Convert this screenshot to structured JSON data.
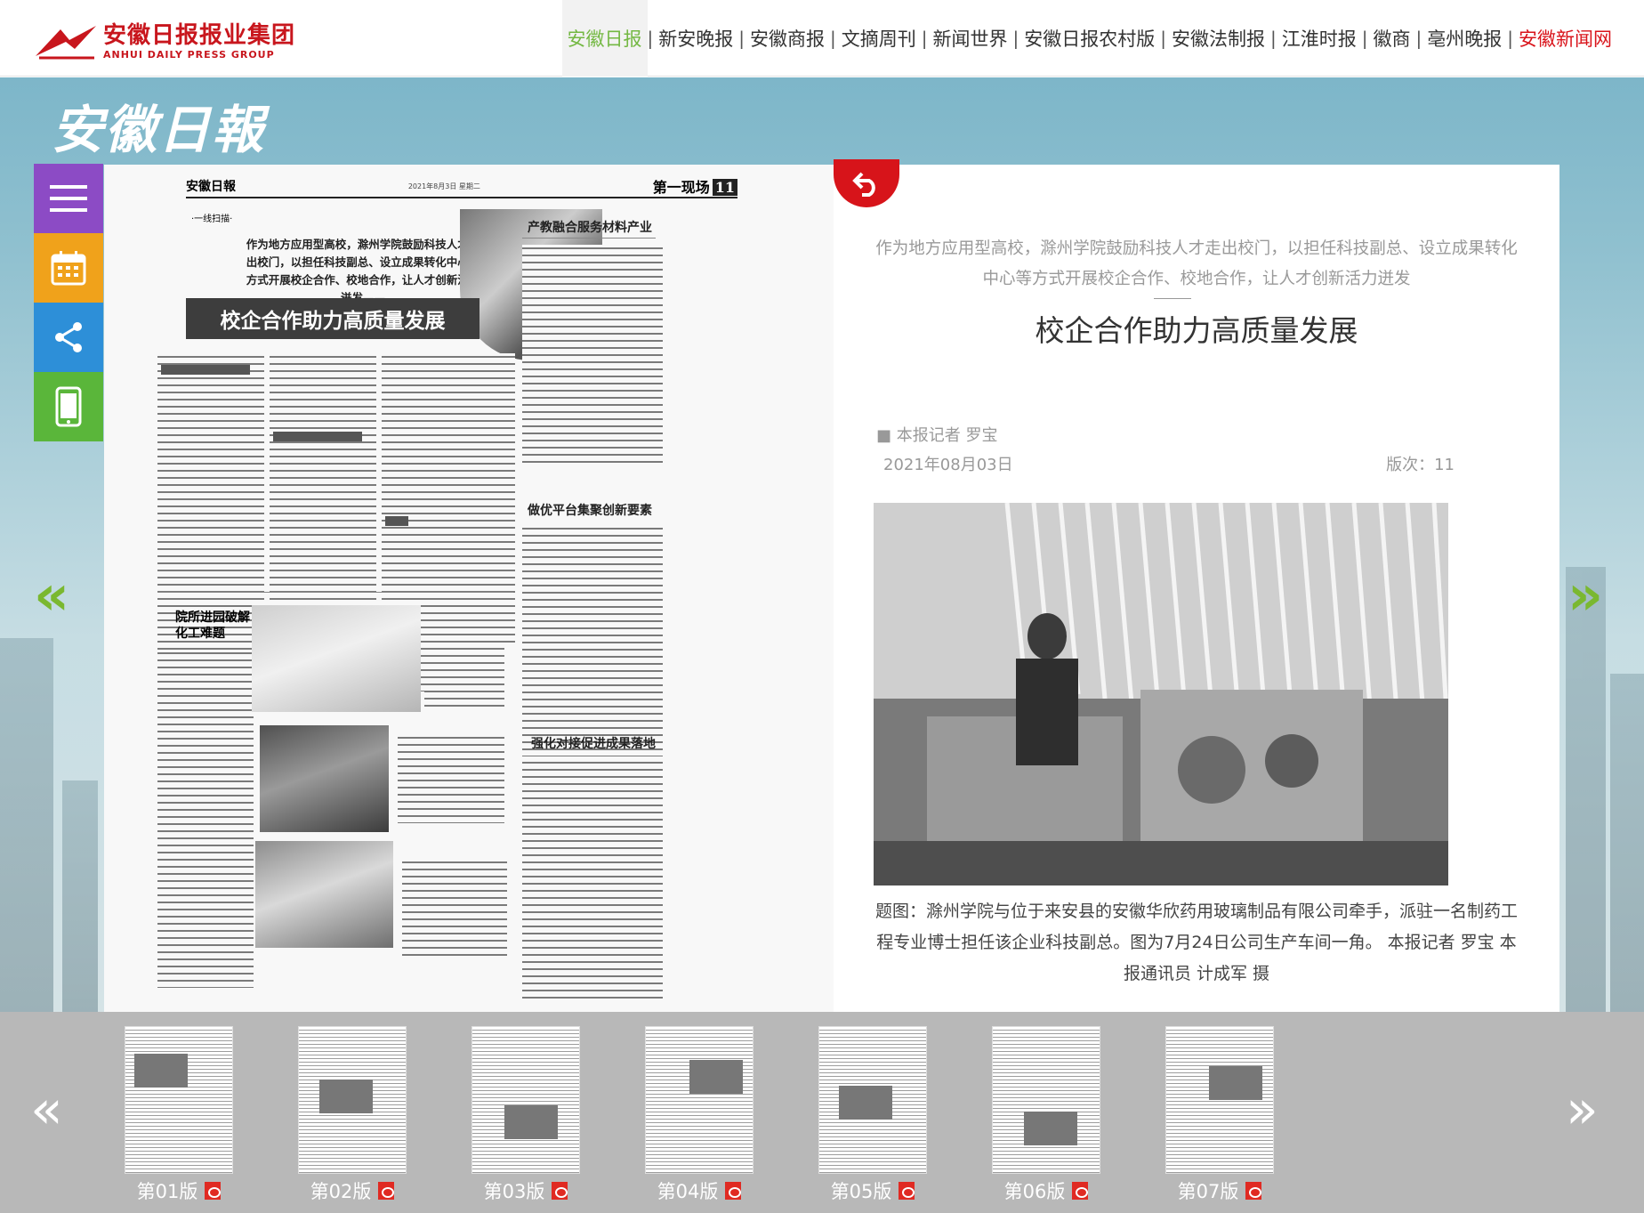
{
  "header": {
    "logo_cn": "安徽日报报业集团",
    "logo_en": "ANHUI DAILY PRESS GROUP",
    "nav": [
      {
        "label": "安徽日报",
        "active": true
      },
      {
        "label": "新安晚报"
      },
      {
        "label": "安徽商报"
      },
      {
        "label": "文摘周刊"
      },
      {
        "label": "新闻世界"
      },
      {
        "label": "安徽日报农村版"
      },
      {
        "label": "安徽法制报"
      },
      {
        "label": "江淮时报"
      },
      {
        "label": "徽商"
      },
      {
        "label": "亳州晚报"
      },
      {
        "label": "安徽新闻网",
        "red": true
      }
    ],
    "separator": "|"
  },
  "paper_name": "安徽日報",
  "sidebar": {
    "buttons": [
      {
        "icon": "menu-icon",
        "color": "#8c4bc5"
      },
      {
        "icon": "calendar-icon",
        "color": "#f0a21b"
      },
      {
        "icon": "share-icon",
        "color": "#2d8fd8"
      },
      {
        "icon": "mobile-icon",
        "color": "#5ab63a"
      }
    ]
  },
  "newspaper": {
    "masthead": "安徽日報",
    "masthead_sub": "2021年8月3日 星期二",
    "section": "第一现场",
    "page_no": "11",
    "tag": "·一线扫描·",
    "lead": "作为地方应用型高校，滁州学院鼓励科技人才走出校门，以担任科技副总、设立成果转化中心等方式开展校企合作、校地合作，让人才创新活力迸发——",
    "headline": "校企合作助力高质量发展",
    "sub1": "产教融合服务材料产业",
    "sub2": "做优平台集聚创新要素",
    "sub3": "院所进园破解化工难题",
    "sub4": "强化对接促进成果落地"
  },
  "article": {
    "lead": "作为地方应用型高校，滁州学院鼓励科技人才走出校门，以担任科技副总、设立成果转化中心等方式开展校企合作、校地合作，让人才创新活力迸发",
    "title": "校企合作助力高质量发展",
    "author": "■ 本报记者  罗宝",
    "date": "2021年08月03日",
    "page_label": "版次：11",
    "caption": "题图：滁州学院与位于来安县的安徽华欣药用玻璃制品有限公司牵手，派驻一名制药工程专业博士担任该企业科技副总。图为7月24日公司生产车间一角。  本报记者 罗宝 本报通讯员 计成军 摄"
  },
  "editions": [
    {
      "label": "第01版"
    },
    {
      "label": "第02版"
    },
    {
      "label": "第03版"
    },
    {
      "label": "第04版"
    },
    {
      "label": "第05版"
    },
    {
      "label": "第06版"
    },
    {
      "label": "第07版"
    }
  ],
  "colors": {
    "accent_green": "#74b843",
    "brand_red": "#d7141a",
    "stage_bg": "#7db6c9"
  }
}
